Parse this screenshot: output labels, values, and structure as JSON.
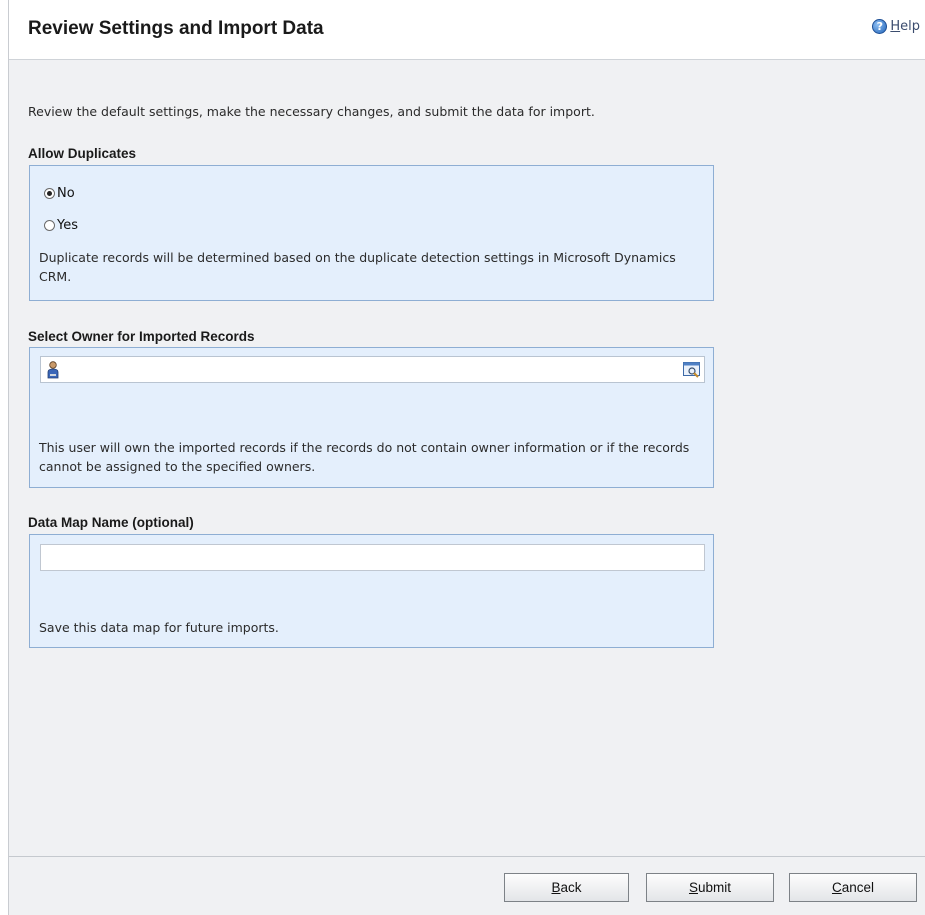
{
  "header": {
    "title": "Review Settings and Import Data",
    "help_label": "Help",
    "help_label_rest": "elp",
    "help_label_access": "H"
  },
  "intro": "Review the default settings, make the necessary changes, and submit the data for import.",
  "duplicates": {
    "label": "Allow Duplicates",
    "options": [
      {
        "label": "No",
        "selected": true
      },
      {
        "label": "Yes",
        "selected": false
      }
    ],
    "description": "Duplicate records will be determined based on the duplicate detection settings in Microsoft Dynamics CRM."
  },
  "owner": {
    "label": "Select Owner for Imported Records",
    "value": "",
    "description": "This user will own the imported records if the records do not contain owner information or if the records cannot be assigned to the specified owners."
  },
  "datamap": {
    "label": "Data Map Name (optional)",
    "value": "",
    "description": "Save this data map for future imports."
  },
  "footer": {
    "back": {
      "access": "B",
      "rest": "ack",
      "label": "Back"
    },
    "submit": {
      "access": "S",
      "rest": "ubmit",
      "label": "Submit"
    },
    "cancel": {
      "access": "C",
      "rest": "ancel",
      "label": "Cancel"
    }
  },
  "icons": {
    "help": "help-icon",
    "user": "user-icon",
    "lookup": "lookup-icon"
  }
}
